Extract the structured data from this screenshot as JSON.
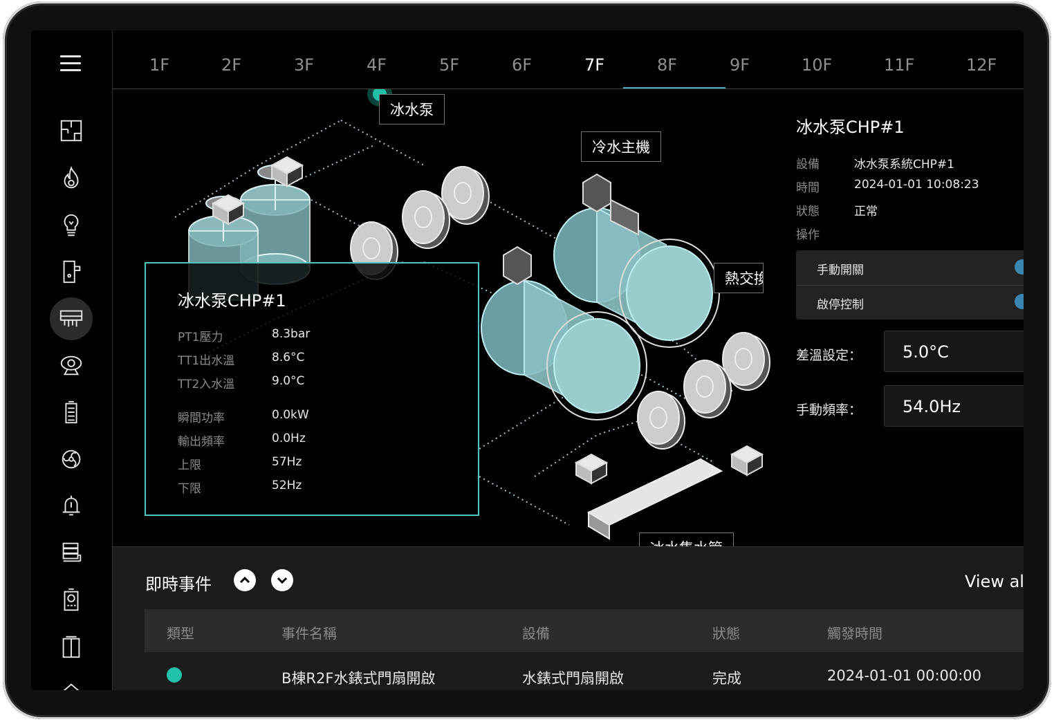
{
  "sidebar": {
    "menu_icon": "hamburger-icon",
    "items": [
      {
        "icon": "floorplan-icon"
      },
      {
        "icon": "fire-icon"
      },
      {
        "icon": "lightbulb-icon"
      },
      {
        "icon": "access-door-icon"
      },
      {
        "icon": "hvac-unit-icon",
        "active": true
      },
      {
        "icon": "camera-icon"
      },
      {
        "icon": "battery-icon"
      },
      {
        "icon": "fan-icon"
      },
      {
        "icon": "alarm-bell-icon"
      },
      {
        "icon": "server-stack-icon"
      },
      {
        "icon": "meter-icon"
      },
      {
        "icon": "elevator-icon"
      }
    ]
  },
  "floors": [
    "1F",
    "2F",
    "3F",
    "4F",
    "5F",
    "6F",
    "7F",
    "8F",
    "9F",
    "10F",
    "11F",
    "12F"
  ],
  "active_floor": "7F",
  "diagram": {
    "labels": {
      "pump": "冰水泵",
      "chiller": "冷水主機",
      "heat_exchanger": "熱交換",
      "header": "冰水集水管"
    }
  },
  "info_panel": {
    "title": "冰水泵CHP#1",
    "rows": [
      {
        "label": "PT1壓力",
        "value": "8.3bar"
      },
      {
        "label": "TT1出水溫",
        "value": "8.6°C"
      },
      {
        "label": "TT2入水溫",
        "value": "9.0°C"
      },
      {
        "label": "瞬間功率",
        "value": "0.0kW"
      },
      {
        "label": "輸出頻率",
        "value": "0.0Hz"
      },
      {
        "label": "上限",
        "value": "57Hz"
      },
      {
        "label": "下限",
        "value": "52Hz"
      }
    ]
  },
  "right_panel": {
    "title": "冰水泵CHP#1",
    "device_label": "設備",
    "device_value": "冰水泵系統CHP#1",
    "time_label": "時間",
    "time_value": "2024-01-01 10:08:23",
    "status_label": "狀態",
    "status_value": "正常",
    "op_label": "操作",
    "manual_switch": "手動開關",
    "start_stop": "啟停控制",
    "temp_diff_label": "差溫設定：",
    "temp_diff_value": "5.0°C",
    "manual_freq_label": "手動頻率：",
    "manual_freq_value": "54.0Hz",
    "toggle_color": "#3b86b0"
  },
  "events": {
    "title": "即時事件",
    "view_all": "View all",
    "columns": [
      "類型",
      "事件名稱",
      "設備",
      "狀態",
      "觸發時間"
    ],
    "rows": [
      {
        "type_color": "#1fc1a8",
        "name": "B棟R2F水錶式門扇開啟",
        "device": "水錶式門扇開啟",
        "status": "完成",
        "time": "2024-01-01 00:00:00"
      }
    ]
  },
  "colors": {
    "accent": "#4fc2c2",
    "tab_underline": "#4aa8c8",
    "status_dot": "#1fc1a8"
  }
}
